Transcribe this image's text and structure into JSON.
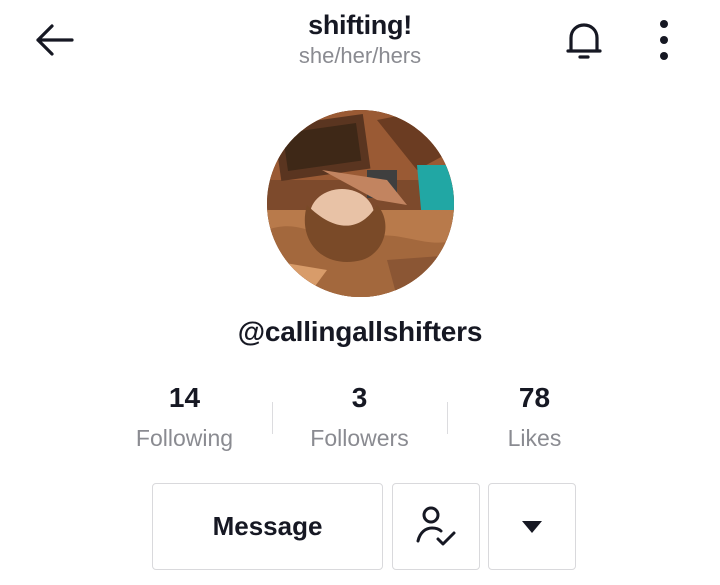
{
  "header": {
    "title": "shifting!",
    "subtitle": "she/her/hers",
    "icons": {
      "back": "back-arrow-icon",
      "notifications": "bell-icon",
      "more": "more-vertical-icon"
    }
  },
  "profile": {
    "username": "@callingallshifters",
    "avatar": "profile-photo"
  },
  "stats": [
    {
      "value": "14",
      "label": "Following"
    },
    {
      "value": "3",
      "label": "Followers"
    },
    {
      "value": "78",
      "label": "Likes"
    }
  ],
  "actions": {
    "message_label": "Message",
    "friend_icon": "user-check-icon",
    "dropdown_icon": "caret-down-icon"
  },
  "colors": {
    "text_primary": "#161823",
    "text_secondary": "#8a8b91",
    "border": "#d9d9dc",
    "background": "#ffffff"
  }
}
